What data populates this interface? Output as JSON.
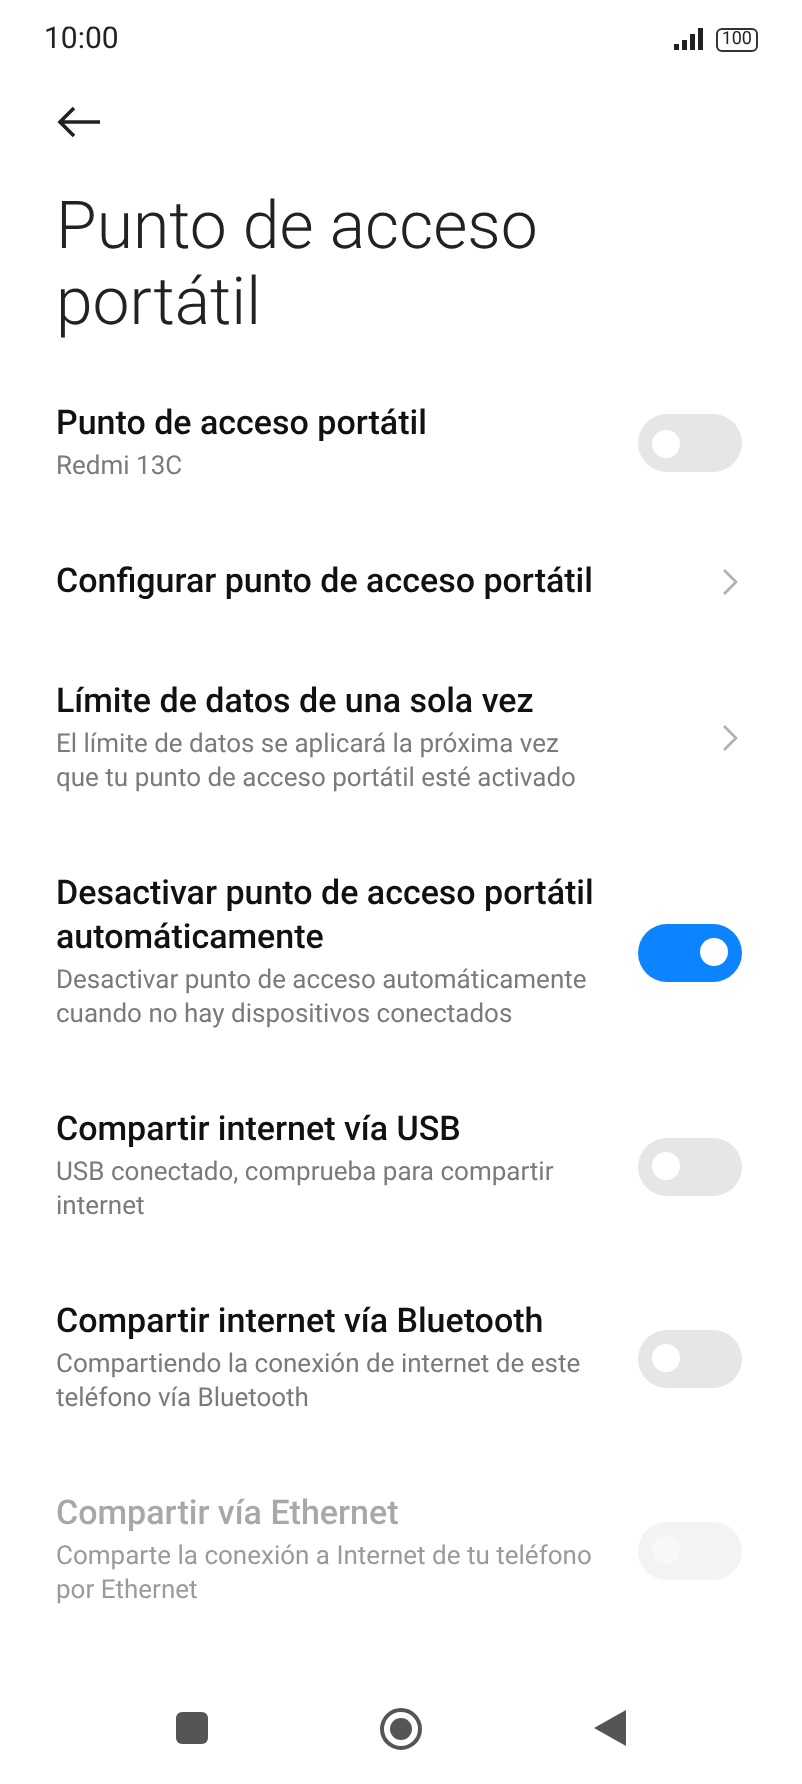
{
  "status_bar": {
    "time": "10:00",
    "battery": "100"
  },
  "title": "Punto de acceso portátil",
  "items": [
    {
      "kind": "toggle",
      "title": "Punto de acceso portátil",
      "subtitle": "Redmi 13C",
      "on": false,
      "disabled": false
    },
    {
      "kind": "link",
      "title": "Configurar punto de acceso portátil",
      "disabled": false
    },
    {
      "kind": "link",
      "title": "Límite de datos de una sola vez",
      "subtitle": "El límite de datos se aplicará la próxima vez que tu punto de acceso portátil esté activado",
      "disabled": false
    },
    {
      "kind": "toggle",
      "title": "Desactivar punto de acceso portátil automáticamente",
      "subtitle": "Desactivar punto de acceso automáticamente cuando no hay dispositivos conectados",
      "on": true,
      "disabled": false
    },
    {
      "kind": "toggle",
      "title": "Compartir internet vía USB",
      "subtitle": "USB conectado, comprueba para compartir internet",
      "on": false,
      "disabled": false
    },
    {
      "kind": "toggle",
      "title": "Compartir internet vía Bluetooth",
      "subtitle": "Compartiendo la conexión de internet de este teléfono vía Bluetooth",
      "on": false,
      "disabled": false
    },
    {
      "kind": "toggle",
      "title": "Compartir vía Ethernet",
      "subtitle": "Comparte la conexión a Internet de tu teléfono por Ethernet",
      "on": false,
      "disabled": true
    }
  ]
}
